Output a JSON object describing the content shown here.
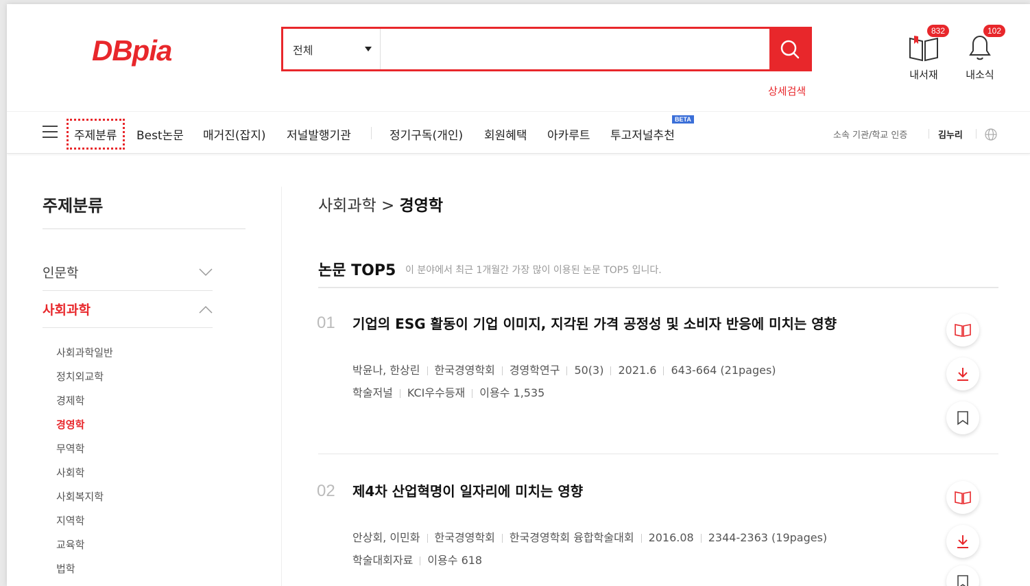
{
  "header": {
    "logo_text": "DBpia",
    "search": {
      "scope": "전체",
      "placeholder": ""
    },
    "advanced_search": "상세검색",
    "utilities": [
      {
        "label": "내서재",
        "badge": "832",
        "icon": "library-book-icon"
      },
      {
        "label": "내소식",
        "badge": "102",
        "icon": "bell-icon"
      }
    ]
  },
  "nav": {
    "items": [
      "주제분류",
      "Best논문",
      "매거진(잡지)",
      "저널발행기관",
      "정기구독(개인)",
      "회원혜택",
      "아카루트",
      "투고저널추천"
    ],
    "beta": "BETA",
    "right": {
      "auth": "소속 기관/학교 인증",
      "user": "김누리"
    }
  },
  "sidebar": {
    "title": "주제분류",
    "categories": [
      {
        "label": "인문학",
        "open": false
      },
      {
        "label": "사회과학",
        "open": true
      }
    ],
    "subcategories": [
      "사회과학일반",
      "정치외교학",
      "경제학",
      "경영학",
      "무역학",
      "사회학",
      "사회복지학",
      "지역학",
      "교육학",
      "법학"
    ],
    "selected": "경영학"
  },
  "main": {
    "breadcrumb_parent": "사회과학 >",
    "breadcrumb_current": "경영학",
    "section_title": "논문 TOP5",
    "section_desc": "이 분야에서 최근 1개월간 가장 많이 이용된 논문 TOP5 입니다.",
    "papers": [
      {
        "rank": "01",
        "title": "기업의 ESG 활동이 기업 이미지, 지각된 가격 공정성 및 소비자 반응에 미치는 영향",
        "authors": "박윤나, 한상린",
        "publisher": "한국경영학회",
        "journal": "경영학연구",
        "volume": "50(3)",
        "date": "2021.6",
        "pages": "643-664 (21pages)",
        "type": "학술저널",
        "tag": "KCI우수등재",
        "usage": "이용수 1,535"
      },
      {
        "rank": "02",
        "title": "제4차 산업혁명이 일자리에 미치는 영향",
        "authors": "안상회, 이민화",
        "publisher": "한국경영학회",
        "journal": "한국경영학회 융합학술대회",
        "date": "2016.08",
        "pages": "2344-2363 (19pages)",
        "type": "학술대회자료",
        "usage": "이용수 618"
      }
    ]
  },
  "colors": {
    "accent": "#e8272b",
    "beta": "#3b6fd8"
  }
}
